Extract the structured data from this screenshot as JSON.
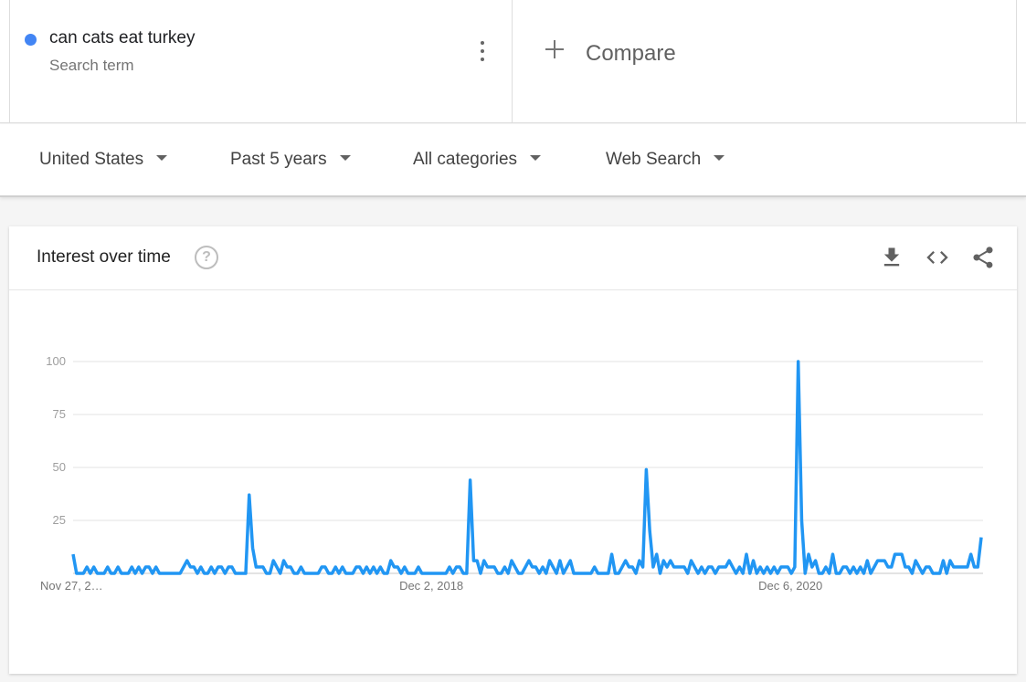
{
  "term": {
    "name": "can cats eat turkey",
    "subtitle": "Search term",
    "color": "#4285f4"
  },
  "compare": {
    "label": "Compare"
  },
  "filters": {
    "region": "United States",
    "period": "Past 5 years",
    "category": "All categories",
    "search_type": "Web Search"
  },
  "card": {
    "title": "Interest over time",
    "help_icon": "question-icon",
    "actions": [
      "download-icon",
      "embed-code-icon",
      "share-icon"
    ]
  },
  "chart_data": {
    "type": "line",
    "ylim": [
      0,
      100
    ],
    "yticks": [
      25,
      50,
      75,
      100
    ],
    "xtick_labels": [
      "Nov 27, 2…",
      "Dec 2, 2018",
      "Dec 6, 2020"
    ],
    "line_color": "#2196f3",
    "grid": true,
    "series": [
      {
        "values": [
          9,
          0,
          0,
          0,
          3,
          0,
          3,
          0,
          0,
          0,
          3,
          0,
          0,
          3,
          0,
          0,
          0,
          3,
          0,
          3,
          0,
          3,
          3,
          0,
          3,
          0,
          0,
          0,
          0,
          0,
          0,
          0,
          3,
          6,
          3,
          3,
          0,
          3,
          0,
          0,
          3,
          0,
          3,
          3,
          0,
          3,
          3,
          0,
          0,
          0,
          0,
          37,
          12,
          3,
          3,
          3,
          0,
          0,
          6,
          3,
          0,
          6,
          3,
          3,
          0,
          0,
          3,
          0,
          0,
          0,
          0,
          0,
          3,
          3,
          0,
          0,
          3,
          0,
          3,
          0,
          0,
          0,
          3,
          3,
          0,
          3,
          0,
          3,
          0,
          3,
          0,
          0,
          6,
          3,
          3,
          0,
          3,
          0,
          0,
          0,
          3,
          0,
          0,
          0,
          0,
          0,
          0,
          0,
          0,
          3,
          0,
          3,
          3,
          0,
          0,
          44,
          6,
          6,
          0,
          6,
          3,
          3,
          3,
          0,
          0,
          3,
          0,
          6,
          3,
          0,
          0,
          3,
          6,
          3,
          3,
          0,
          3,
          0,
          6,
          3,
          0,
          6,
          0,
          3,
          6,
          0,
          0,
          0,
          0,
          0,
          0,
          3,
          0,
          0,
          0,
          0,
          9,
          0,
          0,
          3,
          6,
          3,
          3,
          0,
          6,
          3,
          49,
          20,
          3,
          9,
          0,
          6,
          3,
          6,
          3,
          3,
          3,
          3,
          0,
          6,
          3,
          0,
          3,
          0,
          3,
          3,
          0,
          3,
          3,
          3,
          6,
          3,
          0,
          3,
          0,
          9,
          0,
          6,
          0,
          3,
          0,
          3,
          0,
          3,
          0,
          3,
          3,
          3,
          0,
          3,
          100,
          25,
          0,
          9,
          3,
          6,
          0,
          0,
          3,
          0,
          9,
          0,
          0,
          3,
          3,
          0,
          3,
          0,
          3,
          0,
          6,
          0,
          3,
          6,
          6,
          6,
          3,
          3,
          9,
          9,
          9,
          3,
          3,
          0,
          6,
          3,
          0,
          3,
          3,
          0,
          0,
          0,
          6,
          0,
          6,
          3,
          3,
          3,
          3,
          3,
          9,
          3,
          3,
          17
        ]
      }
    ]
  }
}
